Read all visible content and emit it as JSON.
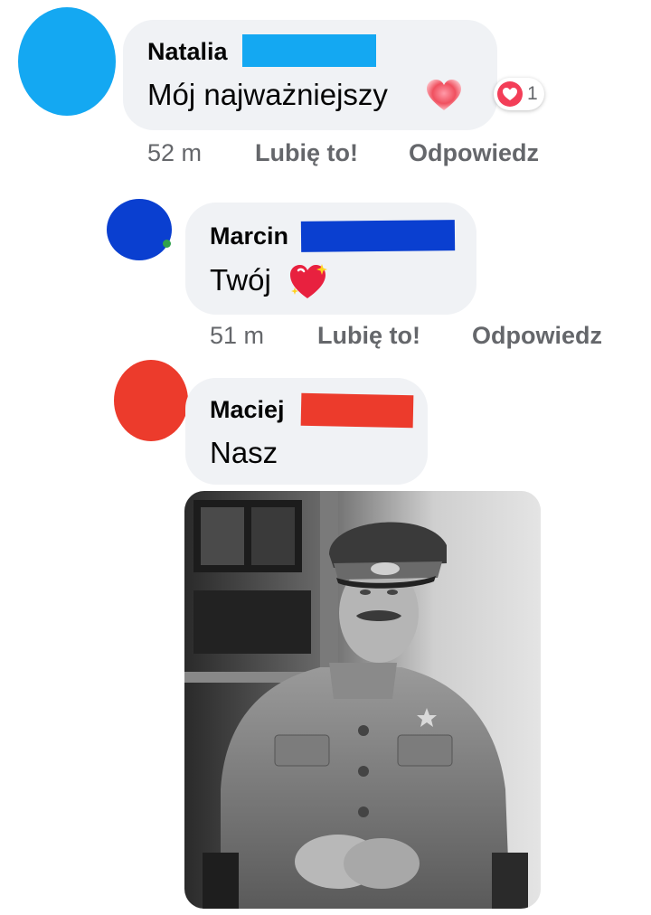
{
  "comments": [
    {
      "author": "Natalia",
      "text": "Mój najważniejszy",
      "emoji_icon": "heart-emoji-icon",
      "reaction_icon": "love-reaction-icon",
      "reaction_count": "1",
      "time": "52 m",
      "like_label": "Lubię to!",
      "reply_label": "Odpowiedz",
      "avatar_color": "#14a8f2",
      "redact_color": "#14a8f2"
    },
    {
      "author": "Marcin",
      "text": "Twój",
      "emoji_icon": "sparkling-heart-emoji-icon",
      "time": "51 m",
      "like_label": "Lubię to!",
      "reply_label": "Odpowiedz",
      "avatar_color": "#0a3fd0",
      "redact_color": "#0a3fd0"
    },
    {
      "author": "Maciej",
      "text": "Nasz",
      "avatar_color": "#ec3b2c",
      "redact_color": "#ec3b2c",
      "attachment_icon": "photo-attachment-icon"
    }
  ],
  "colors": {
    "bubble": "#f0f2f5",
    "meta_text": "#65676b",
    "love_reaction": "#f33e58"
  }
}
